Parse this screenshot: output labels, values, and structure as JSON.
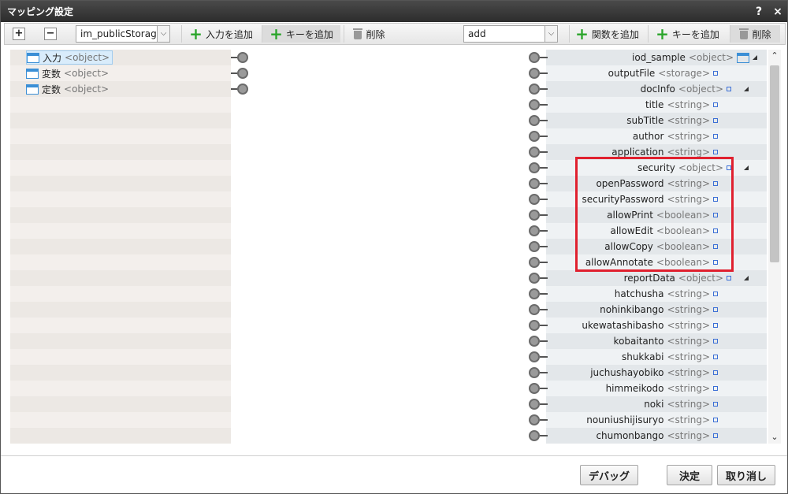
{
  "dialog": {
    "title": "マッピング設定",
    "help_label": "?",
    "close_label": "×"
  },
  "toolbar": {
    "left_select_value": "im_publicStorage",
    "left_add_input": "入力を追加",
    "left_add_key": "キーを追加",
    "left_delete": "削除",
    "right_select_value": "add",
    "right_add_function": "関数を追加",
    "right_add_key": "キーを追加",
    "right_delete": "削除"
  },
  "left_nodes": [
    {
      "name": "入力",
      "type": "<object>"
    },
    {
      "name": "変数",
      "type": "<object>"
    },
    {
      "name": "定数",
      "type": "<object>"
    }
  ],
  "right_nodes": [
    {
      "name": "iod_sample",
      "type": "<object>"
    },
    {
      "name": "outputFile",
      "type": "<storage>"
    },
    {
      "name": "docInfo",
      "type": "<object>"
    },
    {
      "name": "title",
      "type": "<string>"
    },
    {
      "name": "subTitle",
      "type": "<string>"
    },
    {
      "name": "author",
      "type": "<string>"
    },
    {
      "name": "application",
      "type": "<string>"
    },
    {
      "name": "security",
      "type": "<object>"
    },
    {
      "name": "openPassword",
      "type": "<string>"
    },
    {
      "name": "securityPassword",
      "type": "<string>"
    },
    {
      "name": "allowPrint",
      "type": "<boolean>"
    },
    {
      "name": "allowEdit",
      "type": "<boolean>"
    },
    {
      "name": "allowCopy",
      "type": "<boolean>"
    },
    {
      "name": "allowAnnotate",
      "type": "<boolean>"
    },
    {
      "name": "reportData",
      "type": "<object>"
    },
    {
      "name": "hatchusha",
      "type": "<string>"
    },
    {
      "name": "nohinkibango",
      "type": "<string>"
    },
    {
      "name": "ukewatashibasho",
      "type": "<string>"
    },
    {
      "name": "kobaitanto",
      "type": "<string>"
    },
    {
      "name": "shukkabi",
      "type": "<string>"
    },
    {
      "name": "juchushayobiko",
      "type": "<string>"
    },
    {
      "name": "himmeikodo",
      "type": "<string>"
    },
    {
      "name": "noki",
      "type": "<string>"
    },
    {
      "name": "nouniushijisuryo",
      "type": "<string>"
    },
    {
      "name": "chumonbango",
      "type": "<string>"
    }
  ],
  "footer": {
    "debug": "デバッグ",
    "ok": "決定",
    "cancel": "取り消し"
  },
  "colors": {
    "highlight": "#e0202e",
    "accent": "#3b8fd6"
  }
}
